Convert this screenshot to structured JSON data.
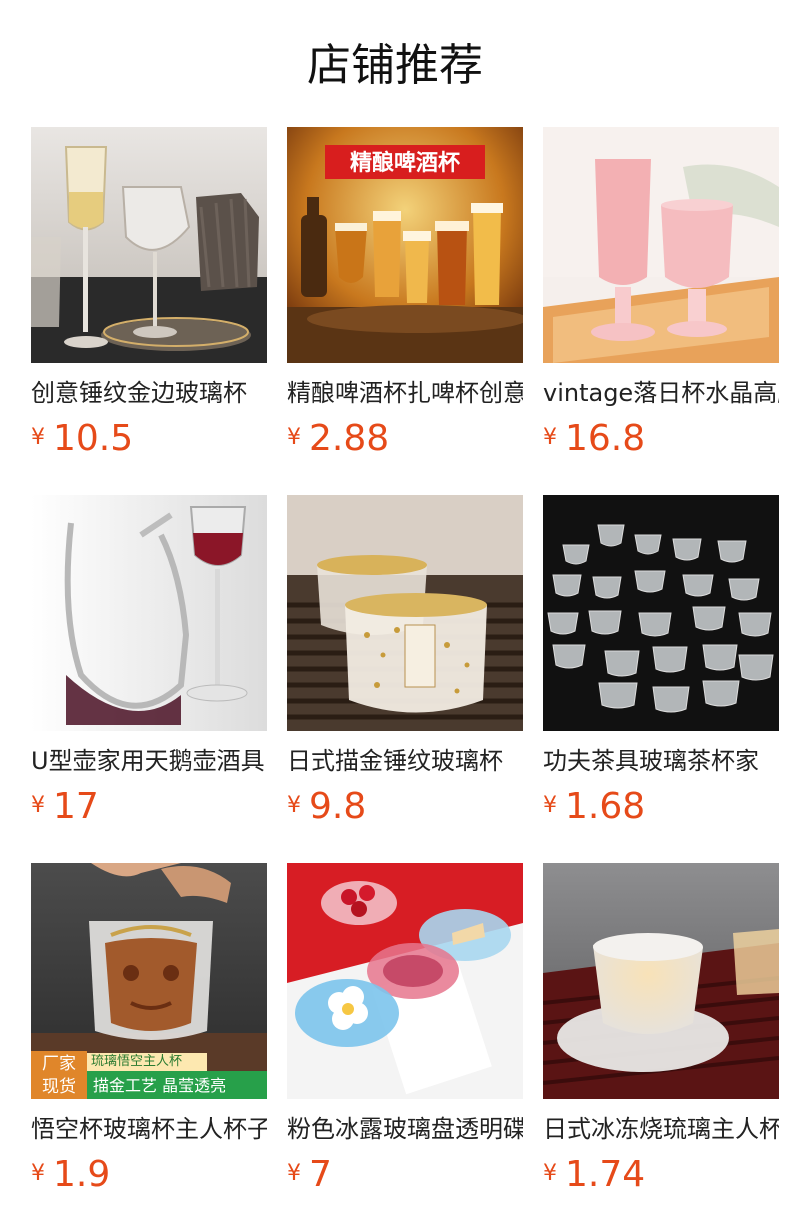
{
  "header": {
    "title": "店铺推荐"
  },
  "currency": "¥",
  "products": [
    {
      "name": "创意锤纹金边玻璃杯",
      "price": "10.5"
    },
    {
      "name": "精酿啤酒杯扎啤杯创意",
      "price": "2.88",
      "image_text": "精酿啤酒杯"
    },
    {
      "name": "vintage落日杯水晶高脚杯",
      "price": "16.8"
    },
    {
      "name": "U型壶家用天鹅壶酒具",
      "price": "17"
    },
    {
      "name": "日式描金锤纹玻璃杯",
      "price": "9.8"
    },
    {
      "name": "功夫茶具玻璃茶杯家",
      "price": "1.68"
    },
    {
      "name": "悟空杯玻璃杯主人杯子",
      "price": "1.9",
      "badge_line1": "厂家",
      "badge_line2": "现货",
      "banner_top": "琉璃悟空主人杯",
      "banner_bottom": "描金工艺 晶莹透亮"
    },
    {
      "name": "粉色冰露玻璃盘透明碟",
      "price": "7"
    },
    {
      "name": "日式冰冻烧琉璃主人杯",
      "price": "1.74"
    }
  ]
}
